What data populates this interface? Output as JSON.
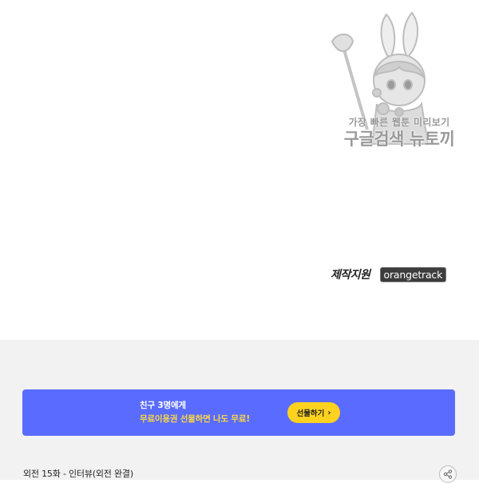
{
  "watermark": {
    "line1": "가장 빠른 웹툰 미리보기",
    "line2": "구글검색 뉴토끼"
  },
  "credit": {
    "label": "제작지원",
    "logo_text": "orangetrack"
  },
  "promo": {
    "line1": "친구 3명에게",
    "line2": "무료이용권 선물하면 나도 무료!",
    "button_label": "선물하기",
    "button_icon": "chevron-right-icon",
    "colors": {
      "background": "#5a6cff",
      "highlight": "#ffd93b",
      "button": "#ffd21f"
    }
  },
  "episode": {
    "title": "외전 15화 - 인터뷰(외전 완결)"
  },
  "share": {
    "icon": "share-icon"
  }
}
